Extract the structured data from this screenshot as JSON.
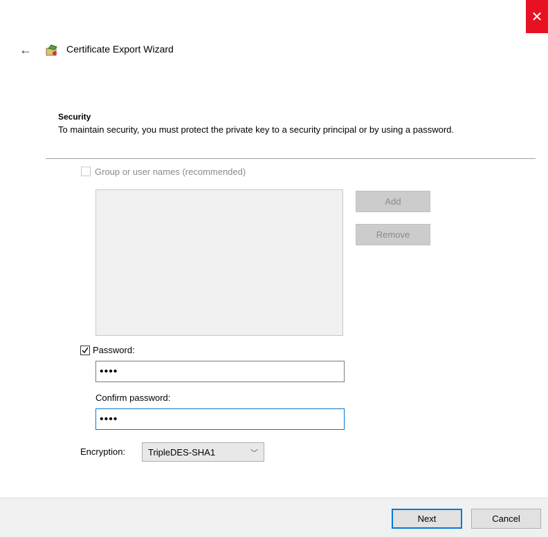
{
  "window": {
    "close_glyph": "✕",
    "close_color": "#e81123"
  },
  "header": {
    "back_glyph": "←",
    "title": "Certificate Export Wizard",
    "icon": "certificate-icon"
  },
  "security": {
    "heading": "Security",
    "description": "To maintain security, you must protect the private key to a security principal or by using a password."
  },
  "group": {
    "label": "Group or user names (recommended)",
    "checked": false,
    "enabled": false
  },
  "buttons": {
    "add": "Add",
    "remove": "Remove",
    "next": "Next",
    "cancel": "Cancel"
  },
  "password": {
    "label": "Password:",
    "checked": true,
    "value": "••••"
  },
  "confirm": {
    "label": "Confirm password:",
    "value": "••••"
  },
  "encryption": {
    "label": "Encryption:",
    "selected": "TripleDES-SHA1"
  },
  "colors": {
    "focus": "#0078d7"
  }
}
